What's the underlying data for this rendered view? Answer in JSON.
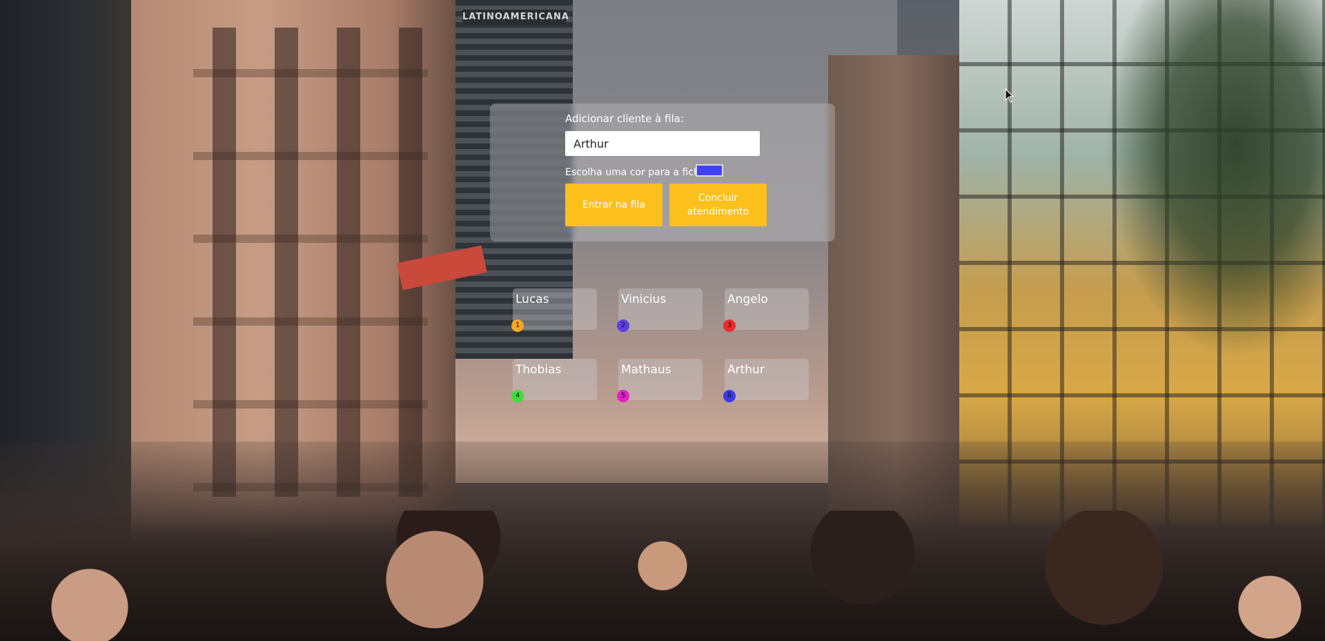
{
  "form": {
    "add_label": "Adicionar cliente à fila:",
    "name_value": "Arthur",
    "color_label": "Escolha uma cor para a ficha:",
    "selected_color": "#4141ff",
    "enter_button": "Entrar na fila",
    "finish_button": "Concluir atendimento",
    "button_color": "#fcc01c"
  },
  "background": {
    "tower_sign": "LATINOAMERICANA"
  },
  "queue": [
    {
      "name": "Lucas",
      "number": "1",
      "color": "#f5a623"
    },
    {
      "name": "Vinicius",
      "number": "2",
      "color": "#5b3fe0"
    },
    {
      "name": "Angelo",
      "number": "3",
      "color": "#ef2a2a"
    },
    {
      "name": "Thobias",
      "number": "4",
      "color": "#3de03a"
    },
    {
      "name": "Mathaus",
      "number": "5",
      "color": "#e41fc8"
    },
    {
      "name": "Arthur",
      "number": "6",
      "color": "#3a3ae8"
    }
  ]
}
